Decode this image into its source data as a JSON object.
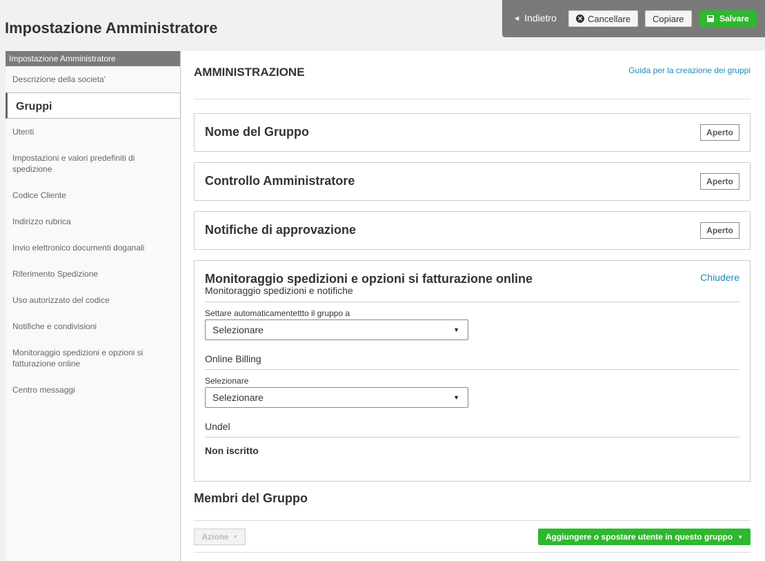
{
  "page": {
    "title": "Impostazione Amministratore"
  },
  "toolbar": {
    "back_label": "Indietro",
    "cancel_label": "Cancellare",
    "copy_label": "Copiare",
    "save_label": "Salvare"
  },
  "sidebar": {
    "header": "Impostazione Amministratore",
    "items": [
      {
        "label": "Descrizione della societa'"
      },
      {
        "label": "Gruppi",
        "active": true
      },
      {
        "label": "Utenti"
      },
      {
        "label": "Impostazioni e valori predefiniti di spedizione"
      },
      {
        "label": "Codice Cliente"
      },
      {
        "label": "Indirizzo rubrica"
      },
      {
        "label": "Invio elettronico documenti doganali"
      },
      {
        "label": "Riferimento Spedizione"
      },
      {
        "label": "Uso autorizzato del codice"
      },
      {
        "label": "Notifiche e condivisioni"
      },
      {
        "label": "Monitoraggio spedizioni e opzioni si fatturazione online"
      },
      {
        "label": "Centro messaggi"
      }
    ]
  },
  "main": {
    "title": "AMMINISTRAZIONE",
    "guide_link": "Guida per la creazione dei gruppi",
    "panels": [
      {
        "title": "Nome del Gruppo",
        "button": "Aperto"
      },
      {
        "title": "Controllo Amministratore",
        "button": "Aperto"
      },
      {
        "title": "Notifiche di approvazione",
        "button": "Aperto"
      }
    ],
    "expanded_panel": {
      "title": "Monitoraggio spedizioni e opzioni si fatturazione online",
      "close_label": "Chiudere",
      "subtitle": "Monitoraggio spedizioni e notifiche",
      "field1_label": "Settare automaticamentettto il gruppo a",
      "field1_value": "Selezionare",
      "section2_label": "Online Billing",
      "field2_label": "Selezionare",
      "field2_value": "Selezionare",
      "section3_label": "Undel",
      "section3_value": "Non iscritto"
    },
    "members": {
      "title": "Membri del Gruppo",
      "action_label": "Azione",
      "add_label": "Aggiungere o spostare utente in questo gruppo"
    }
  },
  "colors": {
    "accent_green": "#2eb82e",
    "link_blue": "#1b8bb4",
    "toolbar_gray": "#7a7a7a"
  }
}
